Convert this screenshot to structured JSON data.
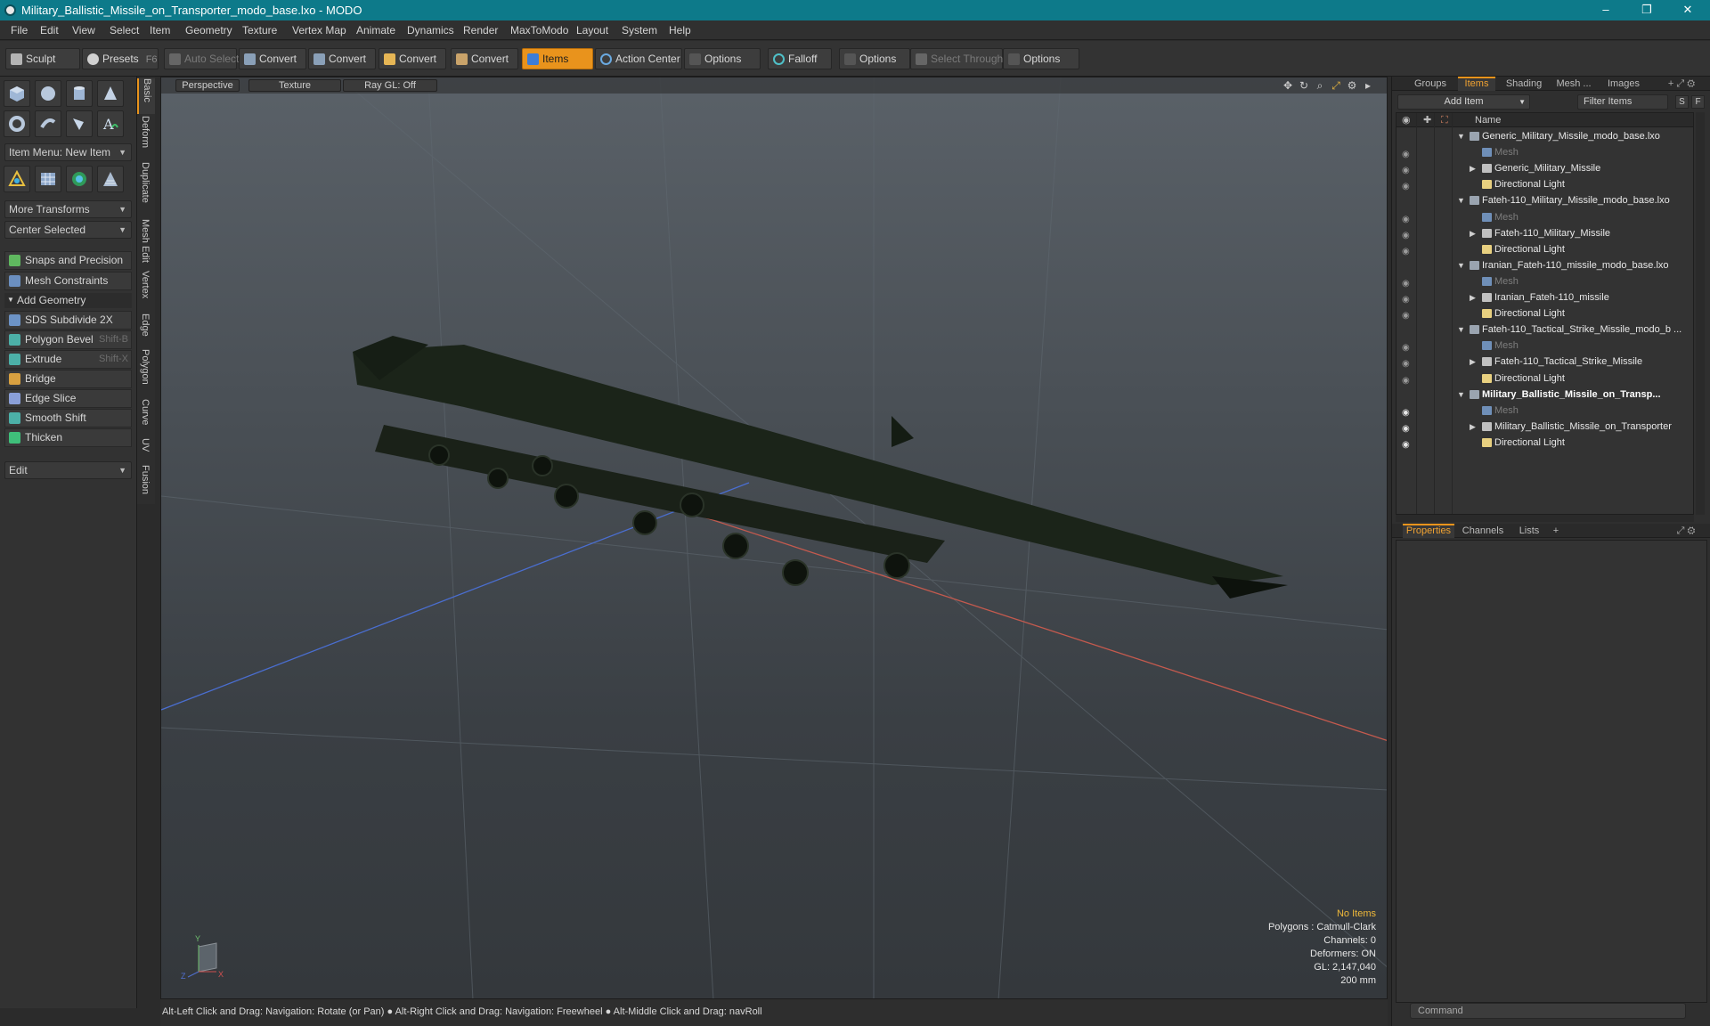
{
  "window": {
    "title": "Military_Ballistic_Missile_on_Transporter_modo_base.lxo - MODO",
    "minimize": "–",
    "restore": "❐",
    "close": "✕"
  },
  "menu": [
    "File",
    "Edit",
    "View",
    "Select",
    "Item",
    "Geometry",
    "Texture",
    "Vertex Map",
    "Animate",
    "Dynamics",
    "Render",
    "MaxToModo",
    "Layout",
    "System",
    "Help"
  ],
  "toolbar": {
    "sculpt": "Sculpt",
    "presets": "Presets",
    "presets_key": "F6",
    "auto_select": "Auto Select",
    "convert1": "Convert",
    "convert2": "Convert",
    "convert3": "Convert",
    "convert4": "Convert",
    "items": "Items",
    "action_center": "Action Center",
    "options1": "Options",
    "falloff": "Falloff",
    "options2": "Options",
    "select_through": "Select Through",
    "options3": "Options"
  },
  "left": {
    "item_menu": "Item Menu: New Item",
    "more_transforms": "More Transforms",
    "center_selected": "Center Selected",
    "snaps": "Snaps and Precision",
    "mesh_constraints": "Mesh Constraints",
    "add_geometry": "Add Geometry",
    "tools": [
      {
        "label": "SDS Subdivide 2X",
        "shortcut": ""
      },
      {
        "label": "Polygon Bevel",
        "shortcut": "Shift-B"
      },
      {
        "label": "Extrude",
        "shortcut": "Shift-X"
      },
      {
        "label": "Bridge",
        "shortcut": ""
      },
      {
        "label": "Edge Slice",
        "shortcut": ""
      },
      {
        "label": "Smooth Shift",
        "shortcut": ""
      },
      {
        "label": "Thicken",
        "shortcut": ""
      }
    ],
    "edit": "Edit"
  },
  "vtabs": [
    "Basic",
    "Deform",
    "Duplicate",
    "Mesh Edit",
    "Vertex",
    "Edge",
    "Polygon",
    "Curve",
    "UV",
    "Fusion"
  ],
  "viewport": {
    "perspective": "Perspective",
    "texture": "Texture",
    "raygl": "Ray GL: Off",
    "stats": {
      "no_items": "No Items",
      "polygons": "Polygons : Catmull-Clark",
      "channels": "Channels: 0",
      "deformers": "Deformers: ON",
      "gl": "GL: 2,147,040",
      "scale": "200 mm"
    }
  },
  "status": "Alt-Left Click and Drag: Navigation: Rotate (or Pan) ● Alt-Right Click and Drag: Navigation: Freewheel ● Alt-Middle Click and Drag: navRoll",
  "right": {
    "tabs": [
      "Groups",
      "Items",
      "Shading",
      "Mesh ...",
      "Images"
    ],
    "add_item": "Add Item",
    "filter": "Filter Items",
    "s": "S",
    "f": "F",
    "name_col": "Name",
    "rows": [
      {
        "label": "Generic_Military_Missile_modo_base.lxo",
        "kind": "scene"
      },
      {
        "label": "Mesh",
        "kind": "mesh"
      },
      {
        "label": "Generic_Military_Missile",
        "kind": "group"
      },
      {
        "label": "Directional Light",
        "kind": "light"
      },
      {
        "label": "Fateh-110_Military_Missile_modo_base.lxo",
        "kind": "scene"
      },
      {
        "label": "Mesh",
        "kind": "mesh"
      },
      {
        "label": "Fateh-110_Military_Missile",
        "kind": "group"
      },
      {
        "label": "Directional Light",
        "kind": "light"
      },
      {
        "label": "Iranian_Fateh-110_missile_modo_base.lxo",
        "kind": "scene"
      },
      {
        "label": "Mesh",
        "kind": "mesh"
      },
      {
        "label": "Iranian_Fateh-110_missile",
        "kind": "group"
      },
      {
        "label": "Directional Light",
        "kind": "light"
      },
      {
        "label": "Fateh-110_Tactical_Strike_Missile_modo_b ...",
        "kind": "scene"
      },
      {
        "label": "Mesh",
        "kind": "mesh"
      },
      {
        "label": "Fateh-110_Tactical_Strike_Missile",
        "kind": "group"
      },
      {
        "label": "Directional Light",
        "kind": "light"
      },
      {
        "label": "Military_Ballistic_Missile_on_Transp...",
        "kind": "scene-bold"
      },
      {
        "label": "Mesh",
        "kind": "mesh"
      },
      {
        "label": "Military_Ballistic_Missile_on_Transporter",
        "kind": "group"
      },
      {
        "label": "Directional Light",
        "kind": "light"
      }
    ],
    "bottom_tabs": [
      "Properties",
      "Channels",
      "Lists"
    ],
    "plus": "+",
    "command": "Command"
  }
}
